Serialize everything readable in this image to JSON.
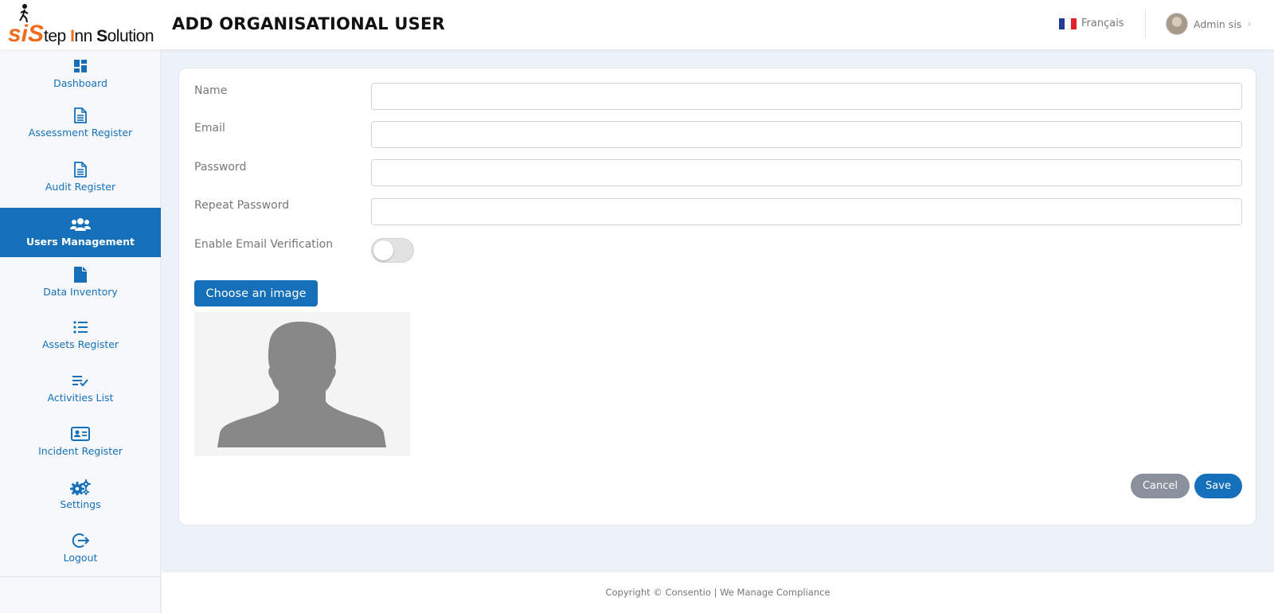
{
  "header": {
    "logo": {
      "s_letters": "siS",
      "tep": "tep ",
      "inn_I": "I",
      "inn_rest": "nn ",
      "sol_S": "S",
      "sol_rest": "olution"
    },
    "title": "ADD ORGANISATIONAL USER",
    "language": "Français",
    "user_name": "Admin sis",
    "flag_colors": [
      "#1f3b94",
      "#ffffff",
      "#e2222b"
    ]
  },
  "sidebar": {
    "items": [
      {
        "label": "Dashboard",
        "icon": "dashboard-icon",
        "active": false
      },
      {
        "label": "Assessment Register",
        "icon": "document-icon",
        "active": false
      },
      {
        "label": "Audit Register",
        "icon": "document-icon",
        "active": false
      },
      {
        "label": "Users Management",
        "icon": "users-icon",
        "active": true
      },
      {
        "label": "Data Inventory",
        "icon": "file-icon",
        "active": false
      },
      {
        "label": "Assets Register",
        "icon": "list-icon",
        "active": false
      },
      {
        "label": "Activities List",
        "icon": "checklist-icon",
        "active": false
      },
      {
        "label": "Incident Register",
        "icon": "id-card-icon",
        "active": false
      },
      {
        "label": "Settings",
        "icon": "gears-icon",
        "active": false
      },
      {
        "label": "Logout",
        "icon": "logout-icon",
        "active": false
      }
    ]
  },
  "form": {
    "name_label": "Name",
    "name_value": "",
    "email_label": "Email",
    "email_value": "",
    "password_label": "Password",
    "password_value": "",
    "repeat_password_label": "Repeat Password",
    "repeat_password_value": "",
    "email_verification_label": "Enable Email Verification",
    "email_verification_enabled": false,
    "choose_image_label": "Choose an image",
    "cancel_label": "Cancel",
    "save_label": "Save"
  },
  "footer": {
    "copyright": "Copyright © Consentio | We Manage Compliance"
  },
  "colors": {
    "primary": "#1570b9",
    "accent": "#f06b1e",
    "cancel": "#8a919c"
  }
}
